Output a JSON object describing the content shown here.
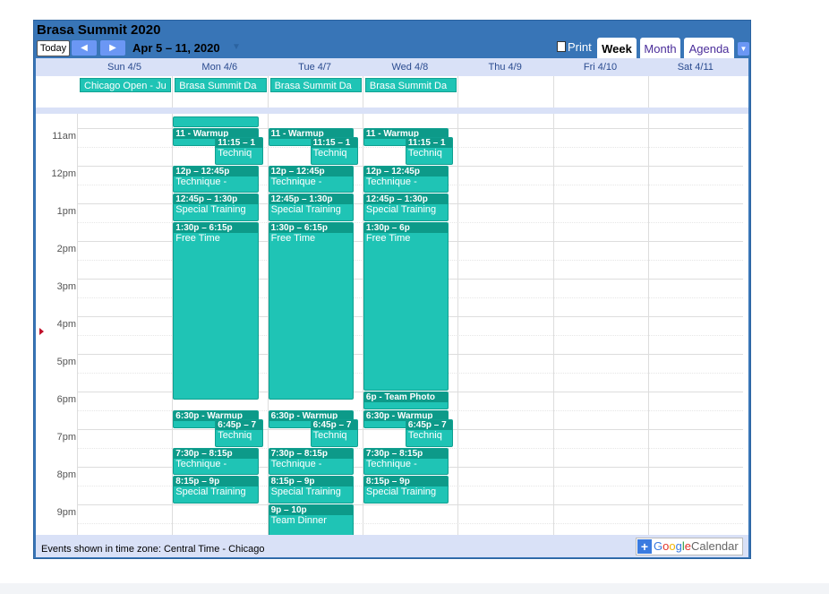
{
  "calendar": {
    "title": "Brasa Summit 2020",
    "nav": {
      "today": "Today",
      "prev": "◀",
      "next": "▶",
      "range": "Apr 5 – 11, 2020",
      "range_caret": "▼"
    },
    "print": "Print",
    "tabs": [
      {
        "label": "Week",
        "active": true
      },
      {
        "label": "Month",
        "active": false
      },
      {
        "label": "Agenda",
        "active": false
      }
    ],
    "tab_dropdown": "▼",
    "days": [
      "Sun 4/5",
      "Mon 4/6",
      "Tue 4/7",
      "Wed 4/8",
      "Thu 4/9",
      "Fri 4/10",
      "Sat 4/11"
    ],
    "allday_events": [
      {
        "day": 0,
        "title": "Chicago Open - Ju"
      },
      {
        "day": 1,
        "title": "Brasa Summit Da"
      },
      {
        "day": 2,
        "title": "Brasa Summit Da"
      },
      {
        "day": 3,
        "title": "Brasa Summit Da"
      }
    ],
    "hours": [
      "11am",
      "12pm",
      "1pm",
      "2pm",
      "3pm",
      "4pm",
      "5pm",
      "6pm",
      "7pm",
      "8pm",
      "9pm"
    ],
    "events": [
      {
        "day": 1,
        "start": 10.7,
        "end": 11.0,
        "head": "",
        "title": "",
        "col": 0
      },
      {
        "day": 1,
        "start": 11.0,
        "end": 11.5,
        "head": "11 - Warmup",
        "title": "",
        "col": 0
      },
      {
        "day": 1,
        "start": 11.25,
        "end": 12.0,
        "head": "11:15 – 1",
        "title": "Techniq",
        "col": 1
      },
      {
        "day": 1,
        "start": 12.0,
        "end": 12.75,
        "head": "12p – 12:45p",
        "title": "Technique - ",
        "col": 0
      },
      {
        "day": 1,
        "start": 12.75,
        "end": 13.5,
        "head": "12:45p – 1:30p",
        "title": "Special Training",
        "col": 0
      },
      {
        "day": 1,
        "start": 13.5,
        "end": 18.25,
        "head": "1:30p – 6:15p",
        "title": "Free Time",
        "col": 0
      },
      {
        "day": 1,
        "start": 18.5,
        "end": 19.0,
        "head": "6:30p - Warmup",
        "title": "",
        "col": 0
      },
      {
        "day": 1,
        "start": 18.75,
        "end": 19.5,
        "head": "6:45p – 7",
        "title": "Techniq",
        "col": 1
      },
      {
        "day": 1,
        "start": 19.5,
        "end": 20.25,
        "head": "7:30p – 8:15p",
        "title": "Technique - ",
        "col": 0
      },
      {
        "day": 1,
        "start": 20.25,
        "end": 21.0,
        "head": "8:15p – 9p",
        "title": "Special Training",
        "col": 0
      },
      {
        "day": 2,
        "start": 11.0,
        "end": 11.5,
        "head": "11 - Warmup",
        "title": "",
        "col": 0
      },
      {
        "day": 2,
        "start": 11.25,
        "end": 12.0,
        "head": "11:15 – 1",
        "title": "Techniq",
        "col": 1
      },
      {
        "day": 2,
        "start": 12.0,
        "end": 12.75,
        "head": "12p – 12:45p",
        "title": "Technique - ",
        "col": 0
      },
      {
        "day": 2,
        "start": 12.75,
        "end": 13.5,
        "head": "12:45p – 1:30p",
        "title": "Special Training",
        "col": 0
      },
      {
        "day": 2,
        "start": 13.5,
        "end": 18.25,
        "head": "1:30p – 6:15p",
        "title": "Free Time",
        "col": 0
      },
      {
        "day": 2,
        "start": 18.5,
        "end": 19.0,
        "head": "6:30p - Warmup",
        "title": "",
        "col": 0
      },
      {
        "day": 2,
        "start": 18.75,
        "end": 19.5,
        "head": "6:45p – 7",
        "title": "Techniq",
        "col": 1
      },
      {
        "day": 2,
        "start": 19.5,
        "end": 20.25,
        "head": "7:30p – 8:15p",
        "title": "Technique - ",
        "col": 0
      },
      {
        "day": 2,
        "start": 20.25,
        "end": 21.0,
        "head": "8:15p – 9p",
        "title": "Special Training",
        "col": 0
      },
      {
        "day": 2,
        "start": 21.0,
        "end": 22.0,
        "head": "9p – 10p",
        "title": "Team Dinner",
        "col": 0
      },
      {
        "day": 3,
        "start": 11.0,
        "end": 11.5,
        "head": "11 - Warmup",
        "title": "",
        "col": 0
      },
      {
        "day": 3,
        "start": 11.25,
        "end": 12.0,
        "head": "11:15 – 1",
        "title": "Techniq",
        "col": 1
      },
      {
        "day": 3,
        "start": 12.0,
        "end": 12.75,
        "head": "12p – 12:45p",
        "title": "Technique - ",
        "col": 0
      },
      {
        "day": 3,
        "start": 12.75,
        "end": 13.5,
        "head": "12:45p – 1:30p",
        "title": "Special Training",
        "col": 0
      },
      {
        "day": 3,
        "start": 13.5,
        "end": 18.0,
        "head": "1:30p – 6p",
        "title": "Free Time",
        "col": 0
      },
      {
        "day": 3,
        "start": 18.0,
        "end": 18.5,
        "head": "6p - Team Photo",
        "title": "",
        "col": 0
      },
      {
        "day": 3,
        "start": 18.5,
        "end": 19.0,
        "head": "6:30p - Warmup",
        "title": "",
        "col": 0
      },
      {
        "day": 3,
        "start": 18.75,
        "end": 19.5,
        "head": "6:45p – 7",
        "title": "Techniq",
        "col": 1
      },
      {
        "day": 3,
        "start": 19.5,
        "end": 20.25,
        "head": "7:30p – 8:15p",
        "title": "Technique - ",
        "col": 0
      },
      {
        "day": 3,
        "start": 20.25,
        "end": 21.0,
        "head": "8:15p – 9p",
        "title": "Special Training",
        "col": 0
      }
    ],
    "now_hour": 16.4,
    "footer": {
      "timezone": "Events shown in time zone: Central Time - Chicago",
      "badge": {
        "plus": "+",
        "letters": [
          "G",
          "o",
          "o",
          "g",
          "l",
          "e"
        ],
        "word": "Calendar"
      }
    },
    "colors": {
      "header_bg": "#3875b7",
      "event": "#1fc4b5",
      "event_header": "#0d9a89",
      "day_header_bg": "#d9e1f7"
    }
  }
}
